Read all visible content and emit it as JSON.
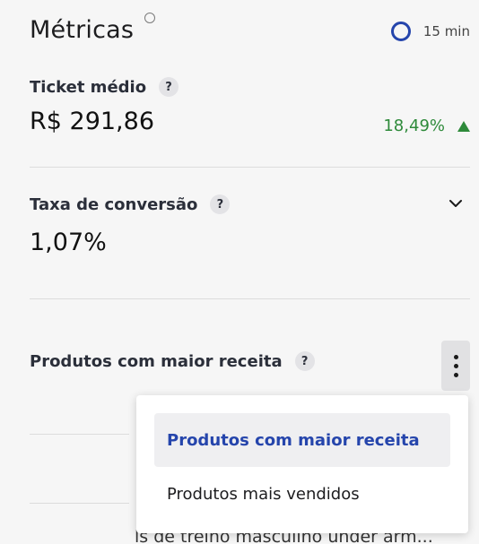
{
  "header": {
    "title": "Métricas",
    "refresh_label": "15 min"
  },
  "ticket_medio": {
    "label": "Ticket médio",
    "help": "?",
    "value": "R$ 291,86",
    "change": "18,49%"
  },
  "taxa_conversao": {
    "label": "Taxa de conversão",
    "help": "?",
    "value": "1,07%"
  },
  "produtos": {
    "label": "Produtos com maior receita",
    "help": "?",
    "truncated_item": "ls de treino masculino under arm..."
  },
  "dropdown": {
    "items": [
      {
        "label": "Produtos com maior receita",
        "selected": true
      },
      {
        "label": "Produtos mais vendidos",
        "selected": false
      }
    ]
  },
  "colors": {
    "accent": "#2545ac",
    "positive": "#2e8a3a"
  },
  "icons": [
    "refresh-ring-icon",
    "help-icon",
    "chevron-down-icon",
    "kebab-menu-icon",
    "triangle-up-icon"
  ]
}
